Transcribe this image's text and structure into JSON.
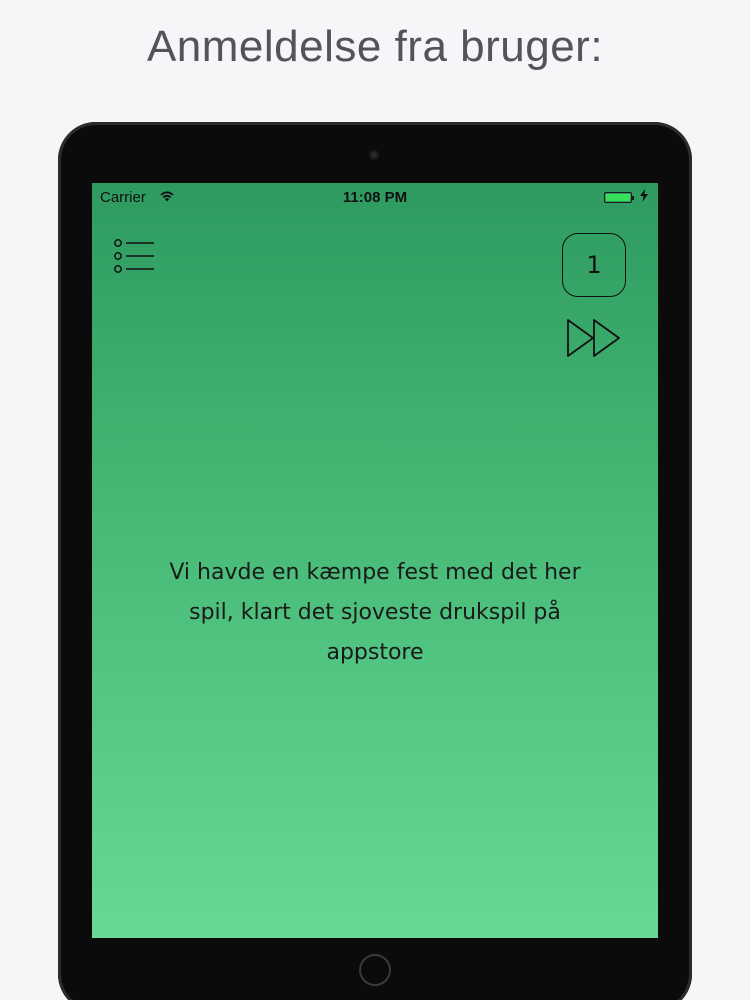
{
  "headline": "Anmeldelse fra bruger:",
  "statusbar": {
    "carrier": "Carrier",
    "time": "11:08 PM",
    "wifi_icon": "wifi-icon",
    "battery_icon": "battery-icon",
    "battery_level": 1.0,
    "charge_icon": "charging-bolt-icon"
  },
  "app": {
    "menu_icon": "list-menu-icon",
    "counter": "1",
    "skip_icon": "fast-forward-icon",
    "review_text": "Vi havde en kæmpe fest med det her spil, klart det sjoveste drukspil på appstore"
  },
  "colors": {
    "page_background": "#f6f5f8",
    "screen_gradient_top": "#2e9a60",
    "screen_gradient_bottom": "#65d995",
    "battery_fill": "#35e05a",
    "device_frame": "#0b0b0c"
  }
}
